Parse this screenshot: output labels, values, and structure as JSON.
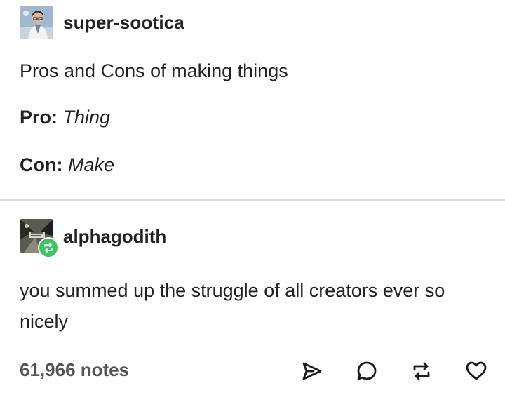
{
  "post": {
    "username": "super-sootica",
    "title": "Pros and Cons of making things",
    "pro_label": "Pro:",
    "pro_value": "Thing",
    "con_label": "Con:",
    "con_value": "Make"
  },
  "reblog": {
    "username": "alphagodith",
    "body": "you summed up the struggle of all creators ever so nicely",
    "badge_color": "#3ec465"
  },
  "footer": {
    "notes": "61,966 notes",
    "icons": [
      "share-icon",
      "reply-icon",
      "reblog-icon",
      "like-icon"
    ]
  }
}
